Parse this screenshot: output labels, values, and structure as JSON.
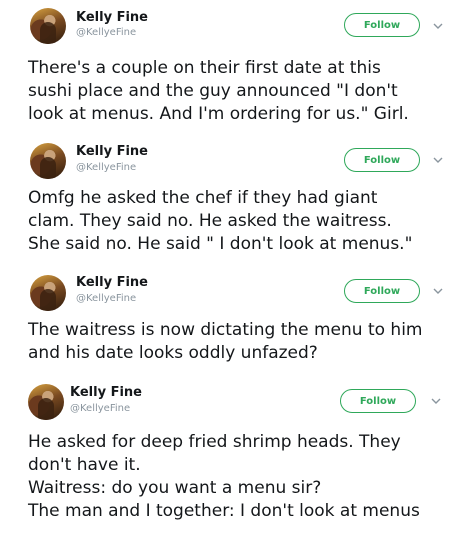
{
  "tweets": [
    {
      "name": "Kelly Fine",
      "handle": "@KellyeFine",
      "follow_label": "Follow",
      "lines": [
        "There's a couple on their first date at this",
        "sushi place and the guy announced \"I don't",
        "look at menus. And I'm ordering for us.\" Girl."
      ]
    },
    {
      "name": "Kelly Fine",
      "handle": "@KellyeFine",
      "follow_label": "Follow",
      "lines": [
        "Omfg he asked the chef if they had giant",
        "clam. They said no. He asked the waitress.",
        "She said no. He said \" I don't look at menus.\""
      ]
    },
    {
      "name": "Kelly Fine",
      "handle": "@KellyeFine",
      "follow_label": "Follow",
      "lines": [
        "The waitress is now dictating the menu to him",
        "and his date looks oddly unfazed?"
      ]
    },
    {
      "name": "Kelly Fine",
      "handle": "@KellyeFine",
      "follow_label": "Follow",
      "lines": [
        "He asked for deep fried shrimp heads. They",
        "don't have it.",
        "Waitress: do you want a menu sir?",
        "The man and I together: I don't look at menus"
      ]
    }
  ],
  "icons": {
    "avatar": "profile-photo",
    "more": "chevron-down-icon"
  },
  "colors": {
    "follow": "#2fa85a",
    "handle": "#8a959e",
    "text": "#14171a"
  }
}
